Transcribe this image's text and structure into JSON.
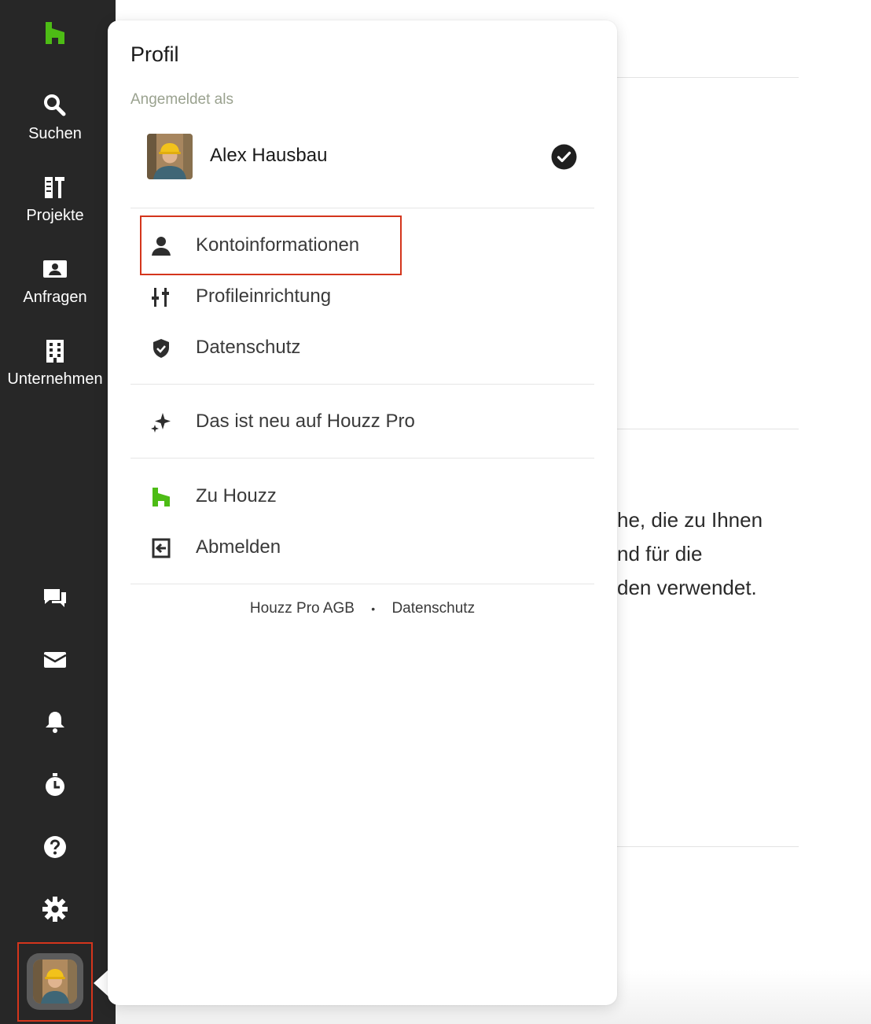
{
  "sidebar": {
    "nav": [
      {
        "label": "Suchen",
        "icon": "search-icon"
      },
      {
        "label": "Projekte",
        "icon": "projects-icon"
      },
      {
        "label": "Anfragen",
        "icon": "inbox-contact-icon"
      },
      {
        "label": "Unternehmen",
        "icon": "building-icon"
      }
    ],
    "utility_icons": [
      "chat-icon",
      "mail-icon",
      "bell-icon",
      "timer-icon",
      "help-icon",
      "gear-icon"
    ],
    "avatar": "profile-avatar"
  },
  "background": {
    "text_lines": [
      "he, die zu Ihnen",
      "nd für die",
      "den verwendet."
    ]
  },
  "profile_menu": {
    "title": "Profil",
    "signed_in_as": "Angemeldet als",
    "user_name": "Alex Hausbau",
    "items": [
      {
        "label": "Kontoinformationen",
        "icon": "person-icon"
      },
      {
        "label": "Profileinrichtung",
        "icon": "tools-icon"
      },
      {
        "label": "Datenschutz",
        "icon": "shield-icon"
      },
      {
        "label": "Das ist neu auf Houzz Pro",
        "icon": "sparkle-icon"
      },
      {
        "label": "Zu Houzz",
        "icon": "houzz-logo-icon"
      },
      {
        "label": "Abmelden",
        "icon": "logout-icon"
      }
    ],
    "footer": {
      "terms": "Houzz Pro AGB",
      "separator": "•",
      "privacy": "Datenschutz"
    }
  },
  "colors": {
    "rail": "#272727",
    "brand_green": "#4dbc15",
    "highlight": "#d4351c"
  }
}
